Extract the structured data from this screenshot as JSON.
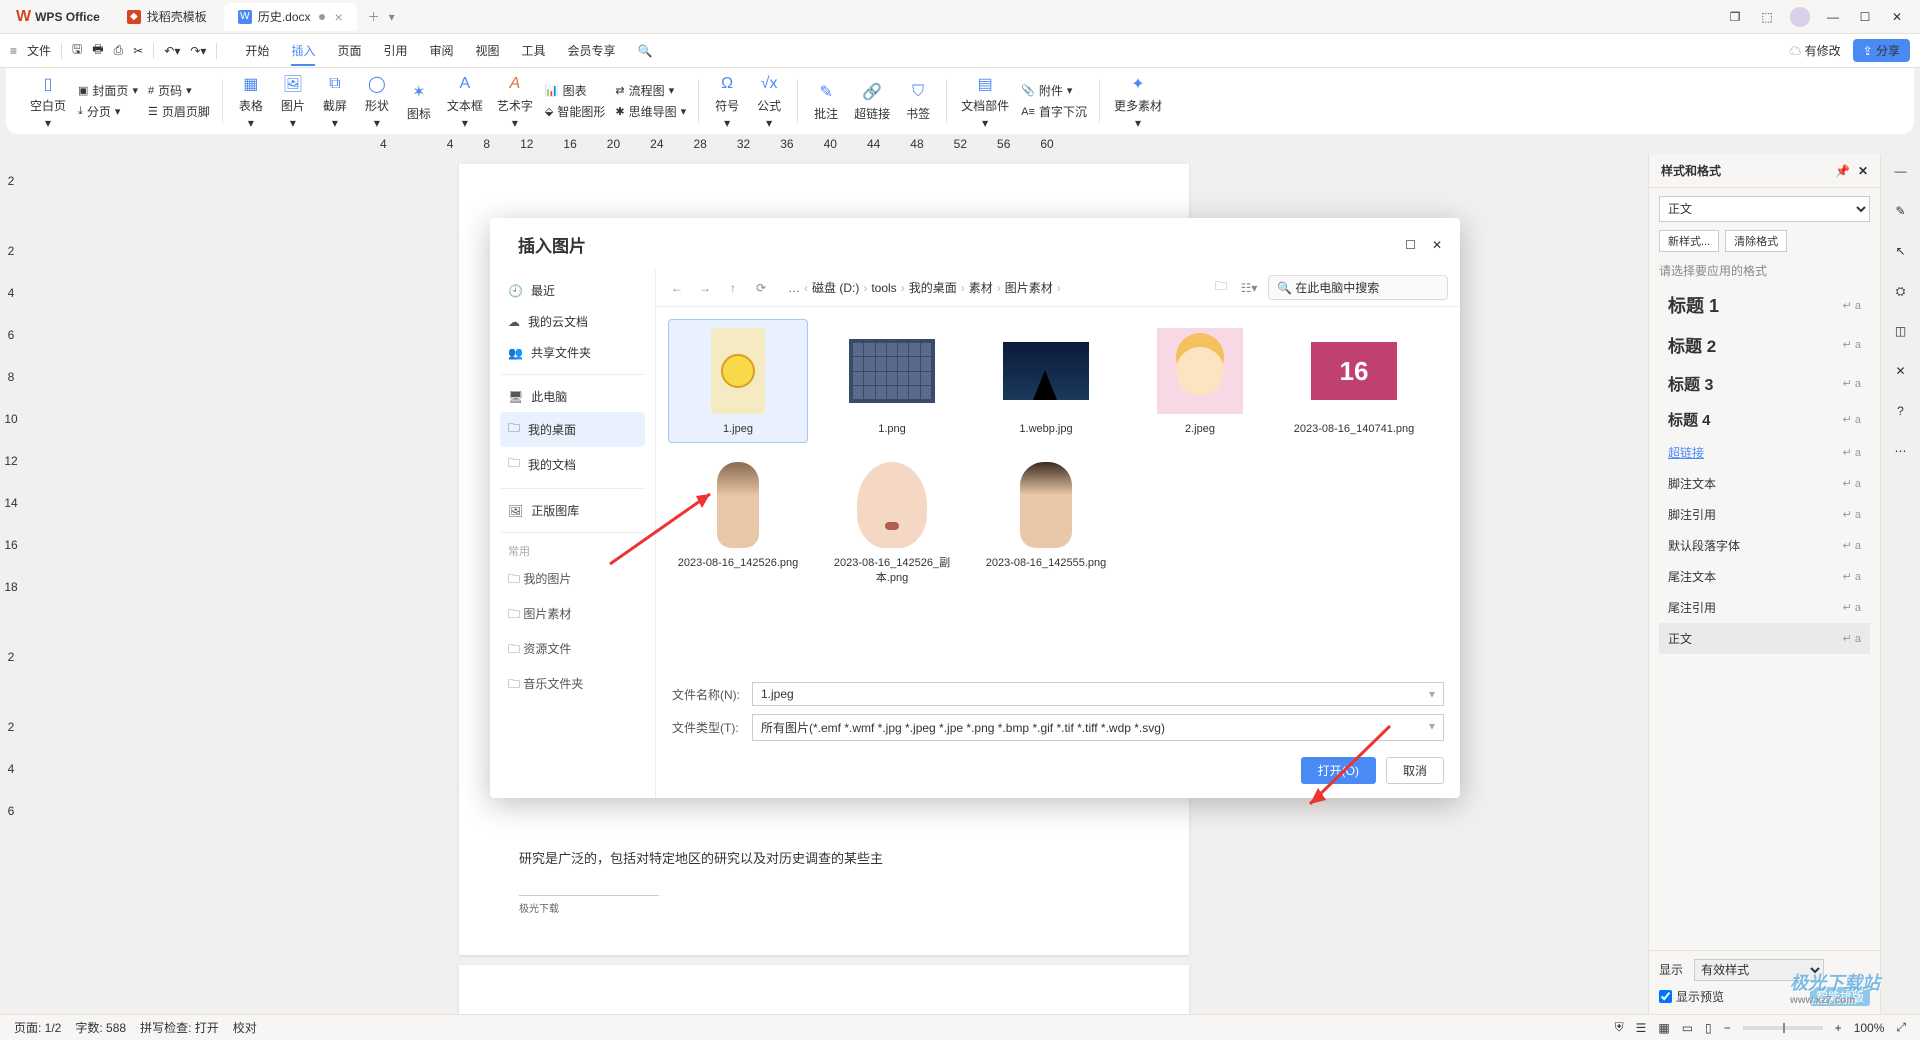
{
  "app_name": "WPS Office",
  "tabs": [
    {
      "icon": "red",
      "label": "找稻壳模板"
    },
    {
      "icon": "blue",
      "label": "历史.docx",
      "active": true,
      "modified": true
    }
  ],
  "menubar": {
    "file": "文件",
    "items": [
      "开始",
      "插入",
      "页面",
      "引用",
      "审阅",
      "视图",
      "工具",
      "会员专享"
    ],
    "active_index": 1,
    "pending": "有修改",
    "share": "分享"
  },
  "ribbon": {
    "blank_page": "空白页",
    "cover": "封面页",
    "page_num": "页码",
    "page_break": "分页",
    "header_footer": "页眉页脚",
    "table": "表格",
    "picture": "图片",
    "screenshot": "截屏",
    "shape": "形状",
    "icon": "图标",
    "textbox": "文本框",
    "wordart": "艺术字",
    "chart": "图表",
    "flowchart_dd": "流程图",
    "smartart": "智能图形",
    "mindmap_dd": "思维导图",
    "symbol": "符号",
    "formula": "公式",
    "comment": "批注",
    "hyperlink": "超链接",
    "bookmark": "书签",
    "doc_parts": "文档部件",
    "attachment": "附件",
    "dropcap": "首字下沉",
    "more": "更多素材"
  },
  "ruler_numbers": [
    "4",
    "",
    "4",
    "8",
    "12",
    "16",
    "20",
    "24",
    "28",
    "32",
    "36",
    "40",
    "44",
    "48",
    "52",
    "56",
    "60"
  ],
  "styles_panel": {
    "title": "样式和格式",
    "current": "正文",
    "new_style": "新样式...",
    "clear": "清除格式",
    "hint": "请选择要应用的格式",
    "list": [
      {
        "label": "标题 1",
        "cls": "h1"
      },
      {
        "label": "标题 2",
        "cls": "h2"
      },
      {
        "label": "标题 3",
        "cls": "h3"
      },
      {
        "label": "标题 4",
        "cls": "h4"
      },
      {
        "label": "超链接",
        "cls": "link-style"
      },
      {
        "label": "脚注文本"
      },
      {
        "label": "脚注引用"
      },
      {
        "label": "默认段落字体"
      },
      {
        "label": "尾注文本"
      },
      {
        "label": "尾注引用"
      },
      {
        "label": "正文",
        "selected": true
      }
    ],
    "show_label": "显示",
    "show_value": "有效样式",
    "preview": "显示预览",
    "smart": "智能排版"
  },
  "document": {
    "visible_line": "研究是广泛的，包括对特定地区的研究以及对历史调查的某些主",
    "footnote": "极光下载"
  },
  "dialog": {
    "title": "插入图片",
    "sidebar": {
      "recent": "最近",
      "cloud": "我的云文档",
      "shared": "共享文件夹",
      "thispc": "此电脑",
      "desktop": "我的桌面",
      "documents": "我的文档",
      "gallery": "正版图库",
      "common_head": "常用",
      "common": [
        "我的图片",
        "图片素材",
        "资源文件",
        "音乐文件夹"
      ]
    },
    "breadcrumb": [
      "磁盘 (D:)",
      "tools",
      "我的桌面",
      "素材",
      "图片素材"
    ],
    "search_placeholder": "在此电脑中搜索",
    "files": [
      {
        "name": "1.jpeg",
        "selected": true,
        "thumb": "cartoon"
      },
      {
        "name": "1.png",
        "thumb": "calendar"
      },
      {
        "name": "1.webp.jpg",
        "thumb": "night"
      },
      {
        "name": "2.jpeg",
        "thumb": "anime"
      },
      {
        "name": "2023-08-16_140741.png",
        "thumb": "num16"
      },
      {
        "name": "2023-08-16_142526.png",
        "thumb": "face1"
      },
      {
        "name": "2023-08-16_142526_副本.png",
        "thumb": "face2"
      },
      {
        "name": "2023-08-16_142555.png",
        "thumb": "face3"
      }
    ],
    "filename_label": "文件名称(N):",
    "filename_value": "1.jpeg",
    "filetype_label": "文件类型(T):",
    "filetype_value": "所有图片(*.emf *.wmf *.jpg *.jpeg *.jpe *.png *.bmp *.gif *.tif *.tiff *.wdp *.svg)",
    "open": "打开(O)",
    "cancel": "取消"
  },
  "statusbar": {
    "page": "页面: 1/2",
    "words": "字数: 588",
    "spell": "拼写检查: 打开",
    "proof": "校对",
    "zoom": "100%"
  },
  "vruler": [
    "2",
    "",
    "2",
    "4",
    "6",
    "8",
    "10",
    "12",
    "14",
    "16",
    "18",
    "",
    "2",
    "",
    "2",
    "4",
    "6"
  ]
}
